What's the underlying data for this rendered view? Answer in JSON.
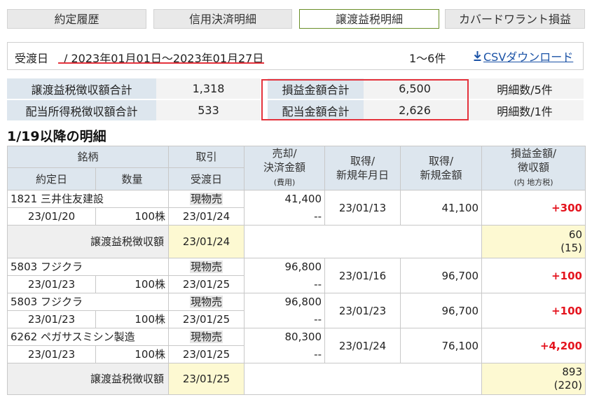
{
  "tabs": [
    {
      "label": "約定履歴",
      "active": false
    },
    {
      "label": "信用決済明細",
      "active": false
    },
    {
      "label": "譲渡益税明細",
      "active": true
    },
    {
      "label": "カバードワラント損益",
      "active": false
    }
  ],
  "date_bar": {
    "label": "受渡日",
    "range": "/ 2023年01月01日〜2023年01月27日",
    "count": "1〜6件",
    "csv_label": "CSVダウンロード"
  },
  "summary": {
    "rows": [
      {
        "label1": "譲渡益税徴収額合計",
        "value1": "1,318",
        "label2": "損益金額合計",
        "value2": "6,500",
        "detail": "明細数/5件"
      },
      {
        "label1": "配当所得税徴収額合計",
        "value1": "533",
        "label2": "配当金額合計",
        "value2": "2,626",
        "detail": "明細数/1件"
      }
    ]
  },
  "section_title": "1/19以降の明細",
  "table": {
    "headers": {
      "stock": "銘柄",
      "trade_date": "約定日",
      "quantity": "数量",
      "transaction": "取引",
      "settle_date": "受渡日",
      "sale_line1": "売却/",
      "sale_line2": "決済金額",
      "sale_line3": "(費用)",
      "acq_date_line1": "取得/",
      "acq_date_line2": "新規年月日",
      "acq_amt_line1": "取得/",
      "acq_amt_line2": "新規金額",
      "pl_line1": "損益金額/",
      "pl_line2": "徴収額",
      "pl_line3": "(内 地方税)"
    },
    "row1": {
      "stock": "1821 三井住友建設",
      "trade_date": "23/01/20",
      "quantity": "100株",
      "transaction": "現物売",
      "settle_date": "23/01/24",
      "sale": "41,400",
      "cost": "--",
      "acq_date": "23/01/13",
      "acq_amount": "41,100",
      "pl": "+300"
    },
    "tax1": {
      "label": "譲渡益税徴収額",
      "date": "23/01/24",
      "amount": "60",
      "local": "(15)"
    },
    "row2": {
      "stock": "5803 フジクラ",
      "trade_date": "23/01/23",
      "quantity": "100株",
      "transaction": "現物売",
      "settle_date": "23/01/25",
      "sale": "96,800",
      "cost": "--",
      "acq_date": "23/01/16",
      "acq_amount": "96,700",
      "pl": "+100"
    },
    "row3": {
      "stock": "5803 フジクラ",
      "trade_date": "23/01/23",
      "quantity": "100株",
      "transaction": "現物売",
      "settle_date": "23/01/25",
      "sale": "96,800",
      "cost": "--",
      "acq_date": "23/01/23",
      "acq_amount": "96,700",
      "pl": "+100"
    },
    "row4": {
      "stock": "6262 ペガサスミシン製造",
      "trade_date": "23/01/23",
      "quantity": "100株",
      "transaction": "現物売",
      "settle_date": "23/01/25",
      "sale": "80,300",
      "cost": "--",
      "acq_date": "23/01/24",
      "acq_amount": "76,100",
      "pl": "+4,200"
    },
    "tax2": {
      "label": "譲渡益税徴収額",
      "date": "23/01/25",
      "amount": "893",
      "local": "(220)"
    }
  },
  "colors": {
    "accent_red": "#e4323c",
    "link_blue": "#1a52a6",
    "header_bg": "#dde6ee",
    "positive": "#e4141e",
    "tax_highlight": "#fdf9d2"
  },
  "icons": {
    "csv": "download-arrow-icon"
  }
}
